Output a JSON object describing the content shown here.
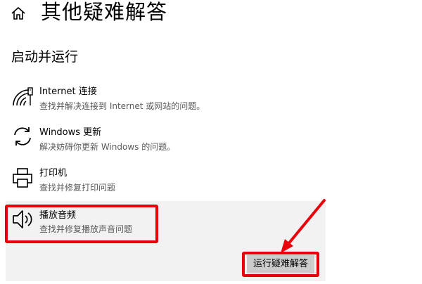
{
  "header": {
    "title": "其他疑难解答",
    "home_icon": "home-icon"
  },
  "section": {
    "title": "启动并运行"
  },
  "items": [
    {
      "name": "Internet 连接",
      "description": "查找并解决连接到 Internet 或网站的问题。",
      "icon": "wifi-network-icon"
    },
    {
      "name": "Windows 更新",
      "description": "解决妨碍你更新 Windows 的问题。",
      "icon": "refresh-icon"
    },
    {
      "name": "打印机",
      "description": "查找并修复打印问题",
      "icon": "printer-icon"
    },
    {
      "name": "播放音频",
      "description": "查找并修复播放声音问题",
      "icon": "speaker-icon"
    }
  ],
  "run_button": {
    "label": "运行疑难解答"
  },
  "colors": {
    "annotation": "#e8000b",
    "selected_background": "#f2f2f2",
    "button_background": "#cccccc",
    "description_text": "#5a5a5a"
  }
}
